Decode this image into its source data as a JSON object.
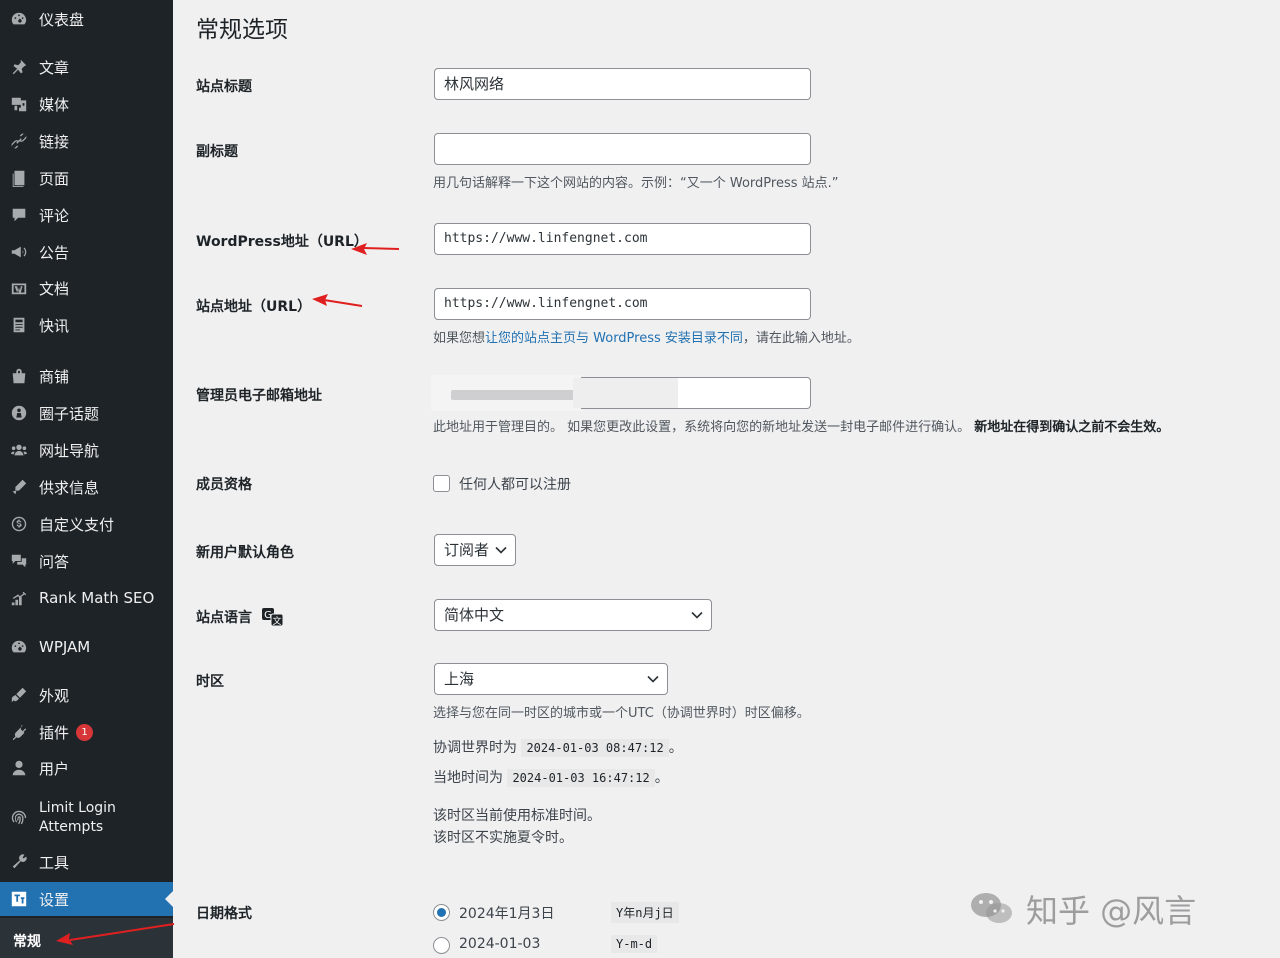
{
  "sidebar": {
    "items": [
      {
        "label": "仪表盘",
        "icon": "dashboard-icon"
      },
      {
        "label": "文章",
        "icon": "pin-icon"
      },
      {
        "label": "媒体",
        "icon": "media-icon"
      },
      {
        "label": "链接",
        "icon": "link-icon"
      },
      {
        "label": "页面",
        "icon": "page-icon"
      },
      {
        "label": "评论",
        "icon": "comment-icon"
      },
      {
        "label": "公告",
        "icon": "megaphone-icon"
      },
      {
        "label": "文档",
        "icon": "docs-icon"
      },
      {
        "label": "快讯",
        "icon": "news-icon"
      },
      {
        "label": "商铺",
        "icon": "shop-icon"
      },
      {
        "label": "圈子话题",
        "icon": "topic-icon"
      },
      {
        "label": "网址导航",
        "icon": "nav-icon"
      },
      {
        "label": "供求信息",
        "icon": "supply-icon"
      },
      {
        "label": "自定义支付",
        "icon": "dollar-icon"
      },
      {
        "label": "问答",
        "icon": "qa-icon"
      },
      {
        "label": "Rank Math SEO",
        "icon": "chart-icon"
      },
      {
        "label": "WPJAM",
        "icon": "gauge-icon"
      },
      {
        "label": "外观",
        "icon": "brush-icon"
      },
      {
        "label": "插件",
        "icon": "plugin-icon",
        "badge": "1"
      },
      {
        "label": "用户",
        "icon": "user-icon"
      },
      {
        "label": "Limit Login Attempts",
        "icon": "fingerprint-icon"
      },
      {
        "label": "工具",
        "icon": "wrench-icon"
      },
      {
        "label": "设置",
        "icon": "settings-icon"
      }
    ],
    "submenu_current": "常规"
  },
  "page": {
    "title": "常规选项",
    "site_title_label": "站点标题",
    "site_title_value": "林风网络",
    "tagline_label": "副标题",
    "tagline_value": "",
    "tagline_desc": "用几句话解释一下这个网站的内容。示例：“又一个 WordPress 站点.”",
    "wp_url_label": "WordPress地址（URL）",
    "wp_url_value": "https://www.linfengnet.com",
    "site_url_label": "站点地址（URL）",
    "site_url_value": "https://www.linfengnet.com",
    "site_url_desc_pre": "如果您想",
    "site_url_desc_link": "让您的站点主页与 WordPress 安装目录不同",
    "site_url_desc_post": "，请在此输入地址。",
    "admin_email_label": "管理员电子邮箱地址",
    "admin_email_desc": "此地址用于管理目的。 如果您更改此设置，系统将向您的新地址发送一封电子邮件进行确认。",
    "admin_email_desc_bold": "新地址在得到确认之前不会生效。",
    "membership_label": "成员资格",
    "membership_checkbox": "任何人都可以注册",
    "default_role_label": "新用户默认角色",
    "default_role_value": "订阅者",
    "language_label": "站点语言",
    "language_value": "简体中文",
    "timezone_label": "时区",
    "timezone_value": "上海",
    "timezone_desc": "选择与您在同一时区的城市或一个UTC（协调世界时）时区偏移。",
    "utc_prefix": "协调世界时为",
    "utc_time": "2024-01-03 08:47:12",
    "local_prefix": "当地时间为",
    "local_time": "2024-01-03 16:47:12",
    "period": "。",
    "std_time_note": "该时区当前使用标准时间。",
    "dst_note": "该时区不实施夏令时。",
    "date_format_label": "日期格式",
    "date_formats": [
      {
        "label": "2024年1月3日",
        "code": "Y年n月j日",
        "selected": true
      },
      {
        "label": "2024-01-03",
        "code": "Y-m-d",
        "selected": false
      }
    ]
  },
  "watermark": "知乎 @风言",
  "colors": {
    "sidebar_bg": "#1d2327",
    "accent": "#2271b1",
    "annotation_arrow": "#e02020"
  }
}
